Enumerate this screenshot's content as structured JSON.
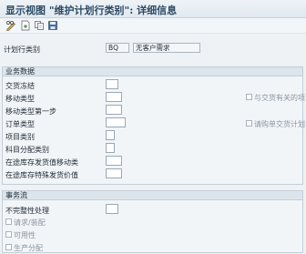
{
  "title": "显示视图 \"维护计划行类别\": 详细信息",
  "toolbar": {
    "icons": [
      "pencil-glasses-icon",
      "new-entry-icon",
      "copy-icon",
      "save-icon"
    ]
  },
  "header": {
    "category_label": "计划行类别",
    "category_value": "BQ",
    "category_desc": "无客户需求"
  },
  "business": {
    "title": "业务数据",
    "fields": [
      "交货冻结",
      "移动类型",
      "移动类型第一步",
      "订单类型",
      "项目类别",
      "科目分配类别",
      "在途库存发货值移动类",
      "在途库存特殊发货价值"
    ],
    "checkboxes": [
      "与交货有关的项",
      "请购单交货计划"
    ]
  },
  "transaction": {
    "title": "事务流",
    "incomplete_label": "不完整性处理",
    "checkboxes": [
      "请求/装配",
      "可用性",
      "生产分配"
    ]
  }
}
